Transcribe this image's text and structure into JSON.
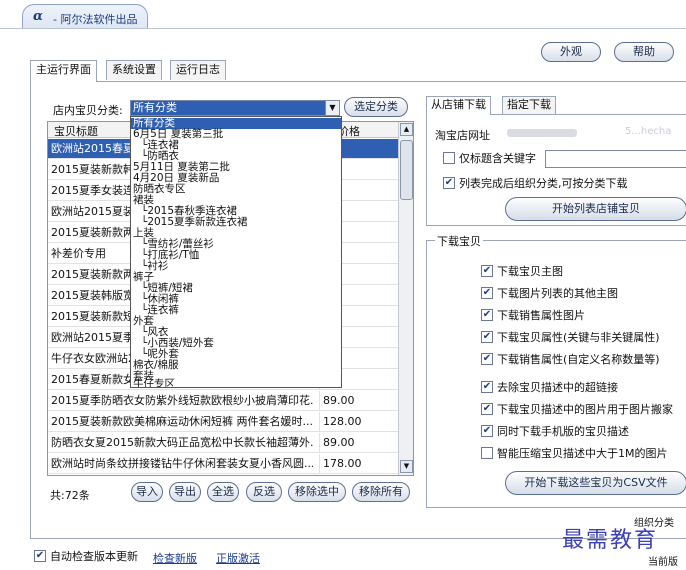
{
  "app": {
    "logo": "α",
    "title": "- 阿尔法软件出品"
  },
  "header_buttons": {
    "appearance": "外观",
    "help": "帮助"
  },
  "tabs": [
    "主运行界面",
    "系统设置",
    "运行日志"
  ],
  "category": {
    "label": "店内宝贝分类:",
    "selected": "所有分类",
    "select_button": "选定分类"
  },
  "dropdown": {
    "options": [
      "所有分类",
      "6月5日 夏装第三批",
      "└连衣裙",
      "└防晒衣",
      "5月11日 夏装第二批",
      "4月20日 夏装新品",
      "防晒衣专区",
      "裙装",
      "└2015春秋季连衣裙",
      "└2015夏季新款连衣裙",
      "上装",
      "└雪纺衫/蕾丝衫",
      "└打底衫/T恤",
      "└衬衫",
      "裤子",
      "└短裤/短裙",
      "└休闲裤",
      "└连衣裤",
      "外套",
      "└风衣",
      "└小西装/短外套",
      "└呢外套",
      "棉衣/棉服",
      "套装",
      "牛仔专区"
    ]
  },
  "table": {
    "headers": [
      "宝贝标题",
      "价格"
    ],
    "rows": [
      {
        "title": "欧洲站2015春夏新款",
        "price": "00"
      },
      {
        "title": "2015夏装新款韩版",
        "price": "00"
      },
      {
        "title": "2015夏季女装连衣",
        "price": "00"
      },
      {
        "title": "欧洲站2015夏装新",
        "price": "00"
      },
      {
        "title": "2015夏装新款两件",
        "price": "00"
      },
      {
        "title": "补差价专用",
        "price": ""
      },
      {
        "title": "2015夏装新款两件",
        "price": "00"
      },
      {
        "title": "2015夏装韩版宽松",
        "price": "00"
      },
      {
        "title": "2015夏装新款短袖",
        "price": "00"
      },
      {
        "title": "欧洲站2015夏季新",
        "price": "00"
      },
      {
        "title": "牛仔衣女欧洲站2",
        "price": "00"
      },
      {
        "title": "2015春夏新款女装",
        "price": "00"
      },
      {
        "title": "2015夏季防晒衣女防紫外线短款欧根纱小披肩薄印花...",
        "price": "89.00"
      },
      {
        "title": "2015夏装新款欧美棉麻运动休闲短裤 两件套名媛时...",
        "price": "128.00"
      },
      {
        "title": "防晒衣女夏2015新款大码正品宽松中长款长袖超薄外...",
        "price": "89.00"
      },
      {
        "title": "欧洲站时尚条纹拼接镂钻牛仔休闲套装女夏小香风圆...",
        "price": "178.00"
      }
    ]
  },
  "bottom_bar": {
    "count": "共:72条",
    "buttons": [
      "导入",
      "导出",
      "全选",
      "反选",
      "移除选中",
      "移除所有"
    ]
  },
  "right_tabs": [
    "从店铺下载",
    "指定下载"
  ],
  "right_panel": {
    "shop_url_label": "淘宝店网址",
    "shop_url_fragment": "5...hecha",
    "keyword_label": "仅标题含关键字",
    "keyword_checked": false,
    "auto_group_label": "列表完成后组织分类,可按分类下载",
    "auto_group_checked": true,
    "start_list_button": "开始列表店铺宝贝"
  },
  "download_group": {
    "title": "下载宝贝",
    "options": [
      {
        "label": "下载宝贝主图",
        "checked": true
      },
      {
        "label": "下载图片列表的其他主图",
        "checked": true
      },
      {
        "label": "下载销售属性图片",
        "checked": true
      },
      {
        "label": "下载宝贝属性(关键与非关键属性)",
        "checked": true
      },
      {
        "label": "下载销售属性(自定义名称数量等)",
        "checked": true
      },
      {
        "label": "去除宝贝描述中的超链接",
        "checked": true
      },
      {
        "label": "下载宝贝描述中的图片用于图片搬家",
        "checked": true
      },
      {
        "label": "同时下载手机版的宝贝描述",
        "checked": true
      },
      {
        "label": "智能压缩宝贝描述中大于1M的图片",
        "checked": false
      }
    ],
    "start_button": "开始下载这些宝贝为CSV文件"
  },
  "footer": {
    "auto_update_label": "自动检查版本更新",
    "auto_update_checked": true,
    "check_link": "检查新版",
    "activate_link": "正版激活",
    "group_status": "组织分类",
    "current": "当前版"
  },
  "watermark": "最需教育"
}
